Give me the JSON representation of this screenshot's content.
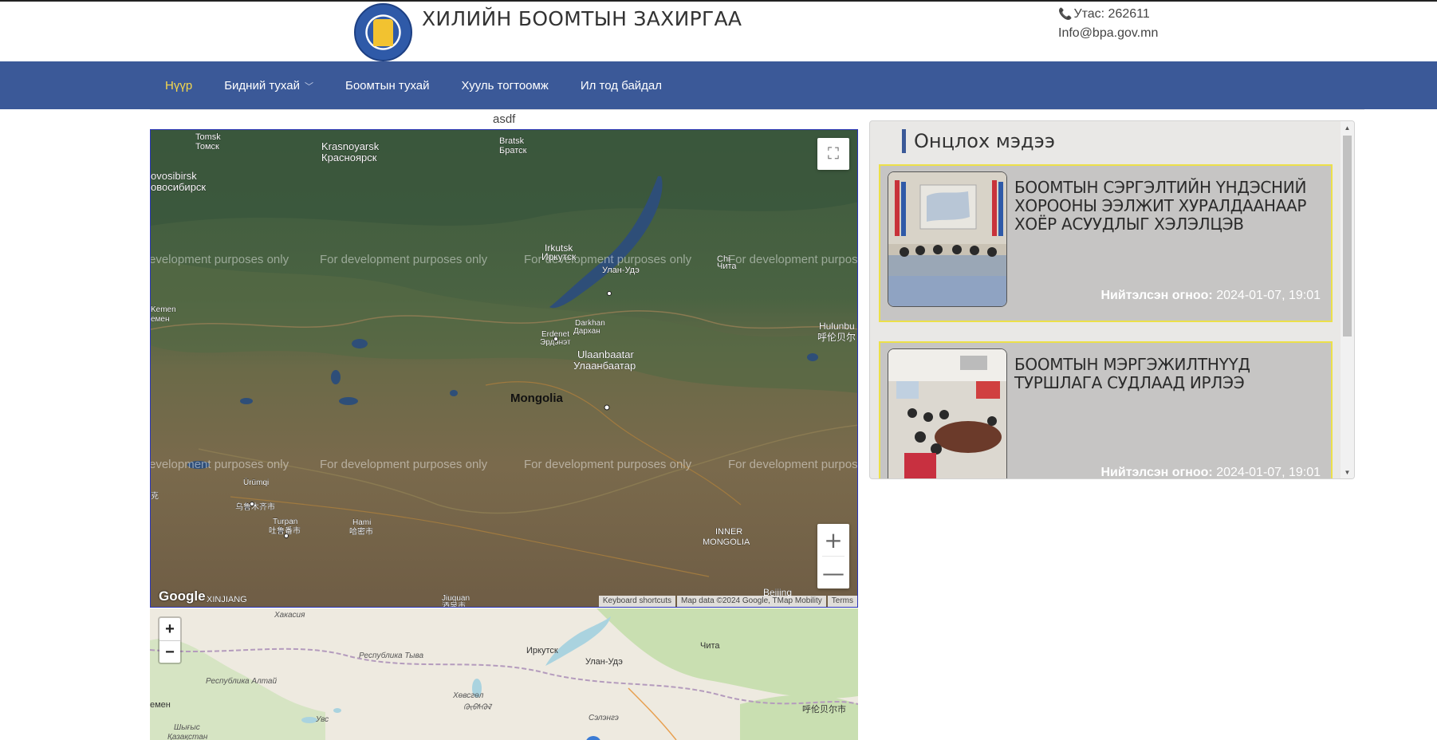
{
  "header": {
    "title": "ХИЛИЙН БООМТЫН ЗАХИРГАА",
    "phone": "Утас: 262611",
    "email": "Info@bpa.gov.mn"
  },
  "nav": {
    "items": [
      {
        "label": "Нүүр",
        "active": true
      },
      {
        "label": "Бидний тухай",
        "dropdown": true
      },
      {
        "label": "Боомтын тухай"
      },
      {
        "label": "Хууль тогтоомж"
      },
      {
        "label": "Ил тод байдал"
      }
    ]
  },
  "map": {
    "caption": "asdf",
    "watermark": "For development purposes only",
    "watermark_left": "evelopment purposes only",
    "watermark_right": "For development purpos",
    "labels": {
      "tomsk": "Tomsk",
      "tomsk_ru": "Томск",
      "krasnoyarsk": "Krasnoyarsk",
      "krasnoyarsk_ru": "Красноярск",
      "bratsk": "Bratsk",
      "bratsk_ru": "Братск",
      "novosibirsk": "ovosibirsk",
      "novosibirsk_ru": "овосибирск",
      "irkutsk": "Irkutsk",
      "irkutsk_ru": "Иркутск",
      "ulan_ude": "Улан-Удэ",
      "chita": "Chi",
      "chita_ru": "Чита",
      "erdenet": "Erdenet",
      "erdenet_mn": "Эрдэнэт",
      "darkhan": "Darkhan",
      "darkhan_mn": "Дархан",
      "ulaanbaatar": "Ulaanbaatar",
      "ulaanbaatar_mn": "Улаанбаатар",
      "mongolia": "Mongolia",
      "hulunbuir": "Hulunbu",
      "hulunbuir_cn": "呼伦贝尔",
      "kemen": "Kemen",
      "kemen_ru": "емен",
      "urumqi": "Ürümqi",
      "urumqi_cn": "乌鲁木齐市",
      "turpan": "Turpan",
      "turpan_cn": "吐鲁番市",
      "hami": "Hami",
      "hami_cn": "哈密市",
      "inner_mongolia_1": "INNER",
      "inner_mongolia_2": "MONGOLIA",
      "xinjiang": "XINJIANG",
      "jiuquan": "Jiuquan",
      "jiuquan_cn": "酒泉市",
      "beijing": "Beijing",
      "kexi": "克"
    },
    "google_logo": "Google",
    "attribution": [
      "Keyboard shortcuts",
      "Map data ©2024 Google, TMap Mobility",
      "Terms"
    ],
    "fullscreen_icon": "fullscreen-icon",
    "zoom_in": "+",
    "zoom_out": "—"
  },
  "osm": {
    "zoom_in": "+",
    "zoom_out": "−",
    "labels": {
      "khakassia": "Хакасия",
      "tyva": "Республика Тыва",
      "altai": "Республика Алтай",
      "irkutsk": "Иркутск",
      "ulan_ude": "Улан-Удэ",
      "chita": "Чита",
      "khovsgol": "Хөвсгөл",
      "khovsgol_mn": "ᠬᠥᠪᠰᠭᠥᠯ",
      "uvs": "Увс",
      "selenge": "Сэлэнгэ",
      "kemen": "емен",
      "shygys": "Шығыс",
      "kazakhstan": "Қазақстан",
      "hulunbuir": "呼伦贝尔市"
    }
  },
  "news": {
    "heading": "Онцлох мэдээ",
    "date_label": "Нийтэлсэн огноо:",
    "items": [
      {
        "title": "БООМТЫН СЭРГЭЛТИЙН ҮНДЭСНИЙ ХОРООНЫ ЭЭЛЖИТ ХУРАЛДААНААР ХОЁР АСУУДЛЫГ ХЭЛЭЛЦЭВ",
        "date": "2024-01-07, 19:01"
      },
      {
        "title": "БООМТЫН МЭРГЭЖИЛТНҮҮД ТУРШЛАГА СУДЛААД ИРЛЭЭ",
        "date": "2024-01-07, 19:01"
      }
    ]
  },
  "colors": {
    "nav_bg": "#3b5998",
    "nav_active": "#f7d94c",
    "card_border": "#ece04a",
    "card_bg": "#c6c5c4"
  }
}
